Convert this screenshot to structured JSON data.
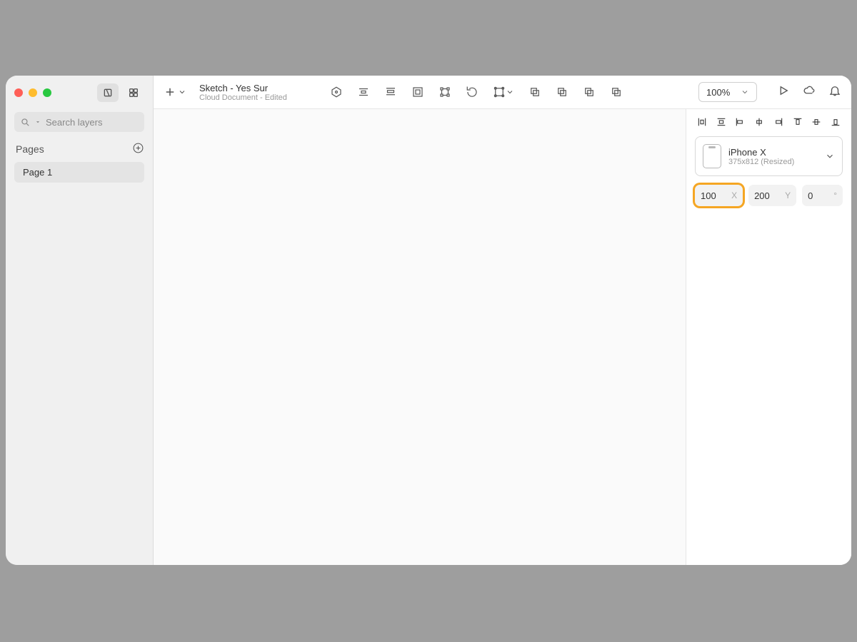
{
  "document": {
    "title": "Sketch - Yes Sur",
    "subtitle": "Cloud Document - Edited"
  },
  "sidebar": {
    "search_placeholder": "Search layers",
    "pages_label": "Pages",
    "pages": [
      {
        "name": "Page 1"
      }
    ]
  },
  "toolbar": {
    "zoom": "100%"
  },
  "inspector": {
    "preset": {
      "name": "iPhone X",
      "detail": "375x812 (Resized)"
    },
    "position": {
      "x": "100",
      "x_label": "X",
      "y": "200",
      "y_label": "Y",
      "rotation": "0",
      "rotation_label": "°"
    }
  }
}
